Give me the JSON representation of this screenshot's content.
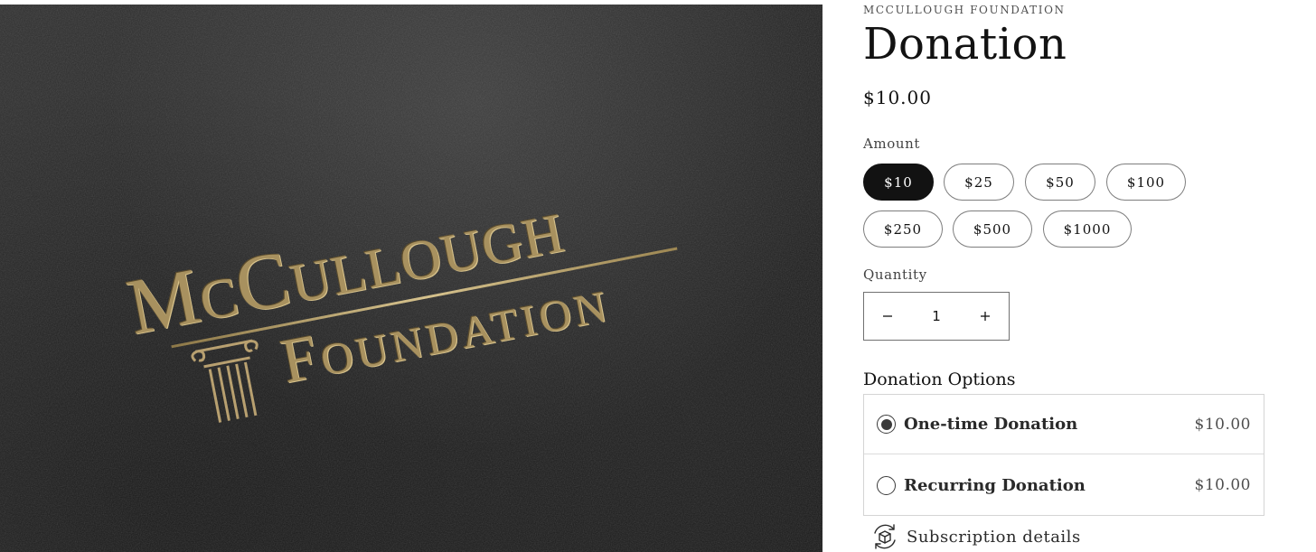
{
  "product_image": {
    "logo_line_1": "McCullough",
    "logo_line_2": "Foundation",
    "logo_color": "#a8915f",
    "background_color": "#262626"
  },
  "product": {
    "vendor": "MCCULLOUGH FOUNDATION",
    "title": "Donation",
    "price": "$10.00"
  },
  "amount": {
    "label": "Amount",
    "selected": "$10",
    "options": [
      "$10",
      "$25",
      "$50",
      "$100",
      "$250",
      "$500",
      "$1000"
    ]
  },
  "quantity": {
    "label": "Quantity",
    "decrease_icon": "minus-icon",
    "increase_icon": "plus-icon",
    "value": "1"
  },
  "donation_options": {
    "title": "Donation Options",
    "options": [
      {
        "name": "One-time Donation",
        "price": "$10.00",
        "selected": true
      },
      {
        "name": "Recurring Donation",
        "price": "$10.00",
        "selected": false
      }
    ]
  },
  "subscription": {
    "icon": "subscription-box-icon",
    "label": "Subscription details"
  },
  "colors": {
    "text": "#121212",
    "selected_pill": "#121212"
  }
}
